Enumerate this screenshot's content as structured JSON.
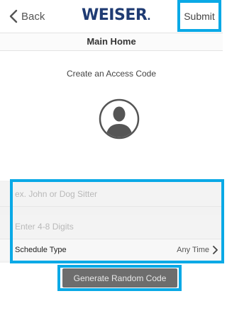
{
  "nav": {
    "back_label": "Back",
    "logo_text": "WEISER",
    "logo_mark": ".",
    "submit_label": "Submit"
  },
  "subheader": {
    "title": "Main Home"
  },
  "main": {
    "heading": "Create an Access Code",
    "avatar_icon": "user-silhouette-icon"
  },
  "form": {
    "name_placeholder": "ex. John or Dog Sitter",
    "digits_placeholder": "Enter 4-8 Digits",
    "schedule_label": "Schedule Type",
    "schedule_value": "Any Time"
  },
  "actions": {
    "generate_label": "Generate Random Code"
  },
  "colors": {
    "highlight": "#0aa9e6",
    "logo": "#1f3b73",
    "button_bg": "#6d6d6d"
  }
}
